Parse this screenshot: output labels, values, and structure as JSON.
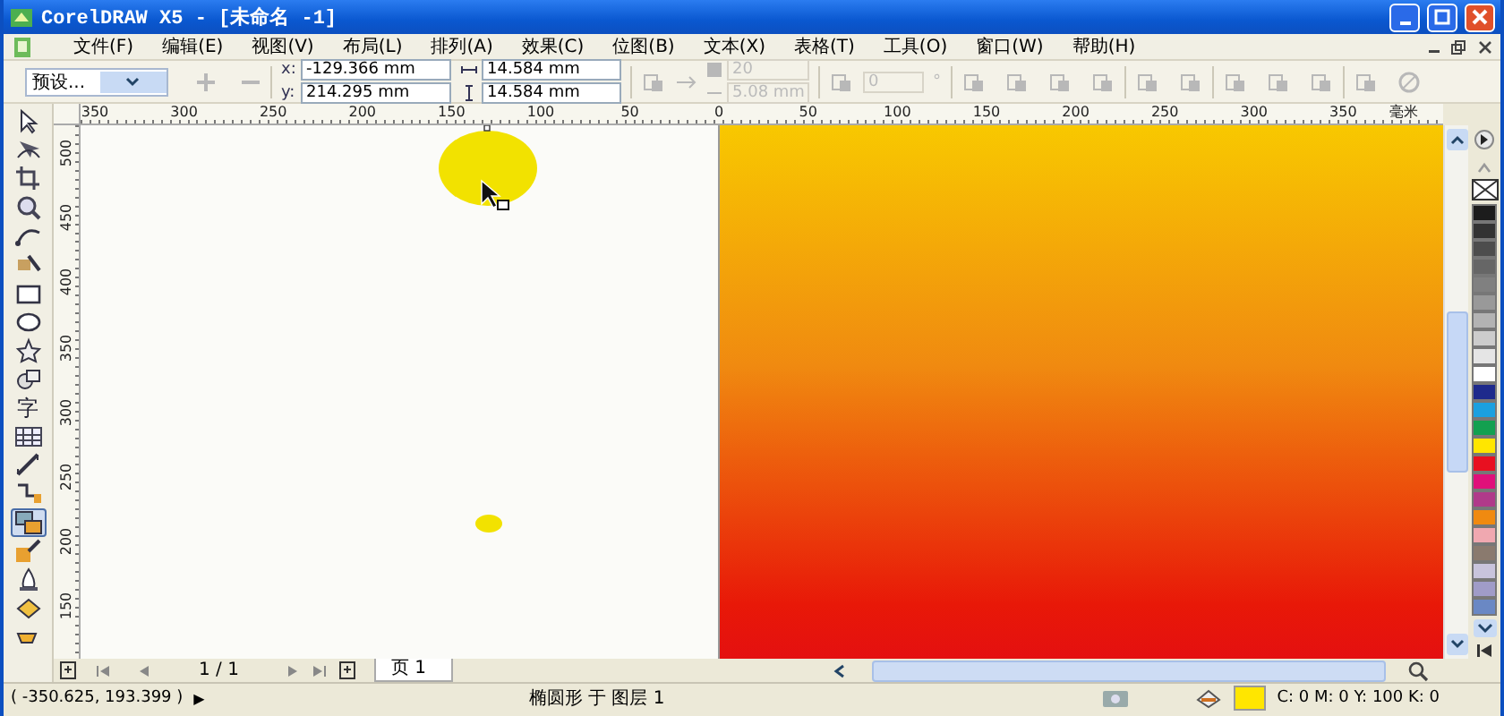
{
  "window": {
    "title": "CorelDRAW X5 - [未命名 -1]"
  },
  "menu": {
    "items": [
      "文件(F)",
      "编辑(E)",
      "视图(V)",
      "布局(L)",
      "排列(A)",
      "效果(C)",
      "位图(B)",
      "文本(X)",
      "表格(T)",
      "工具(O)",
      "窗口(W)",
      "帮助(H)"
    ]
  },
  "property_bar": {
    "preset": "预设...",
    "x_label": "x:",
    "x": "-129.366 mm",
    "y_label": "y:",
    "y": "214.295 mm",
    "width": "14.584 mm",
    "height": "14.584 mm",
    "fields": [
      {
        "value": "20",
        "disabled": true
      },
      {
        "value": "5.08 mm",
        "disabled": true
      },
      {
        "value": "0",
        "disabled": true
      }
    ],
    "degree_sign": "°"
  },
  "rulers": {
    "horizontal": [
      "350",
      "300",
      "250",
      "200",
      "150",
      "100",
      "50",
      "0",
      "50",
      "100",
      "150",
      "200",
      "250",
      "300",
      "350"
    ],
    "unit": "毫米",
    "vertical": [
      "500",
      "450",
      "400",
      "350",
      "300",
      "250",
      "200",
      "150"
    ]
  },
  "toolbox": {
    "tools": [
      {
        "selected": false
      },
      {
        "selected": false
      },
      {
        "selected": false
      },
      {
        "selected": false
      },
      {
        "selected": false
      },
      {
        "selected": false
      },
      {
        "selected": false
      },
      {
        "selected": false
      },
      {
        "selected": false
      },
      {
        "selected": false
      },
      {
        "label": "字",
        "selected": false
      },
      {
        "selected": false
      },
      {
        "selected": false
      },
      {
        "selected": false
      },
      {
        "selected": true
      },
      {
        "selected": false
      },
      {
        "selected": false
      },
      {
        "selected": false
      },
      {
        "selected": false
      }
    ]
  },
  "page_nav": {
    "page_count": "1 / 1",
    "tabs": [
      {
        "label": "页 1",
        "selected": true
      }
    ]
  },
  "palette": {
    "colors": [
      {
        "color": "#1c1c1c"
      },
      {
        "color": "#333333"
      },
      {
        "color": "#4d4d4d"
      },
      {
        "color": "#666666"
      },
      {
        "color": "#808080"
      },
      {
        "color": "#999999"
      },
      {
        "color": "#b3b3b3"
      },
      {
        "color": "#cccccc"
      },
      {
        "color": "#e5e5e5"
      },
      {
        "color": "#ffffff"
      },
      {
        "color": "#1e2a8c"
      },
      {
        "color": "#1ba0e0"
      },
      {
        "color": "#13a050"
      },
      {
        "color": "#ffe600"
      },
      {
        "color": "#e81020"
      },
      {
        "color": "#e0107a"
      },
      {
        "color": "#b03a8a"
      },
      {
        "color": "#f08a10"
      },
      {
        "color": "#f0a8b0"
      },
      {
        "color": "#8a7a6e"
      },
      {
        "color": "#c8c4dc"
      },
      {
        "color": "#a09cc8"
      },
      {
        "color": "#6a88c4"
      }
    ]
  },
  "status_bar": {
    "coordinates": "( -350.625, 193.399 )",
    "arrow": "▶",
    "object_info": "椭圆形 于 图层 1",
    "fill": {
      "color": "#ffe600",
      "values": "C: 0 M: 0 Y: 100 K: 0"
    }
  }
}
